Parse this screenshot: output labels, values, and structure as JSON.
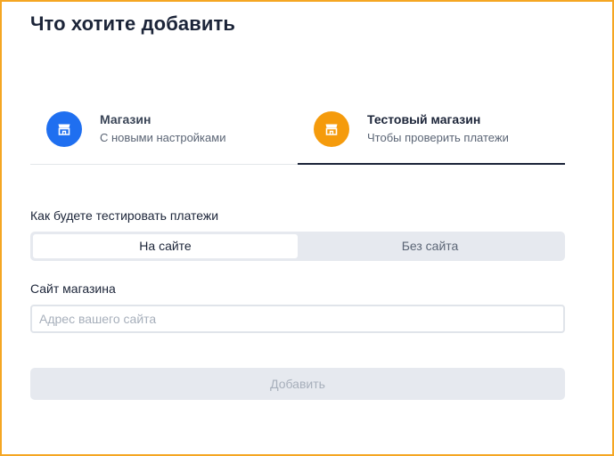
{
  "page": {
    "title": "Что хотите добавить"
  },
  "tabs": [
    {
      "title": "Магазин",
      "subtitle": "С новыми настройками",
      "icon": "store-icon",
      "icon_color": "#1f6ff0",
      "active": false
    },
    {
      "title": "Тестовый магазин",
      "subtitle": "Чтобы проверить платежи",
      "icon": "store-icon",
      "icon_color": "#f59b0c",
      "active": true
    }
  ],
  "payment_test": {
    "label": "Как будете тестировать платежи",
    "options": [
      "На сайте",
      "Без сайта"
    ],
    "selected": "На сайте"
  },
  "site_field": {
    "label": "Сайт магазина",
    "placeholder": "Адрес вашего сайта",
    "value": ""
  },
  "submit": {
    "label": "Добавить",
    "enabled": false
  },
  "colors": {
    "frame_border": "#f5a623",
    "heading_text": "#1b2438",
    "segment_background": "#e6e9ef",
    "disabled_text": "#a7afbb"
  }
}
